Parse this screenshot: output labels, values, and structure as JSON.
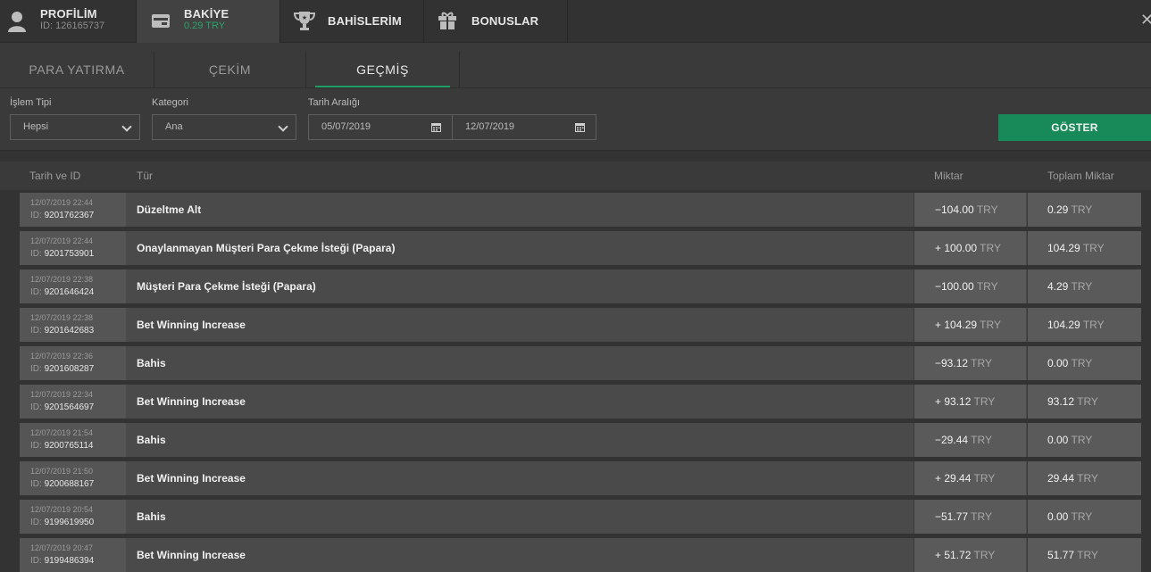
{
  "topnav": {
    "items": [
      {
        "title": "PROFİLİM",
        "sub": "ID: 126165737",
        "icon": "user-icon"
      },
      {
        "title": "BAKİYE",
        "sub": "0.29 TRY",
        "icon": "wallet-icon"
      },
      {
        "title": "BAHİSLERİM",
        "icon": "trophy-icon"
      },
      {
        "title": "BONUSLAR",
        "icon": "gift-icon"
      }
    ],
    "close": "✕"
  },
  "subtabs": [
    "PARA YATIRMA",
    "ÇEKİM",
    "GEÇMİŞ"
  ],
  "filters": {
    "type_label": "İşlem Tipi",
    "type_value": "Hepsi",
    "category_label": "Kategori",
    "category_value": "Ana",
    "date_label": "Tarih Aralığı",
    "date_from": "05/07/2019",
    "date_to": "12/07/2019",
    "show_button": "GÖSTER"
  },
  "table": {
    "headers": [
      "Tarih ve ID",
      "Tür",
      "Miktar",
      "Toplam Miktar"
    ],
    "id_prefix": "ID:",
    "currency": "TRY",
    "rows": [
      {
        "date": "12/07/2019 22:44",
        "id": "9201762367",
        "type": "Düzeltme Alt",
        "amount": "−104.00",
        "total": "0.29"
      },
      {
        "date": "12/07/2019 22:44",
        "id": "9201753901",
        "type": "Onaylanmayan Müşteri Para Çekme İsteği (Papara)",
        "amount": "+ 100.00",
        "total": "104.29"
      },
      {
        "date": "12/07/2019 22:38",
        "id": "9201646424",
        "type": "Müşteri Para Çekme İsteği (Papara)",
        "amount": "−100.00",
        "total": "4.29"
      },
      {
        "date": "12/07/2019 22:38",
        "id": "9201642683",
        "type": "Bet Winning Increase",
        "amount": "+ 104.29",
        "total": "104.29"
      },
      {
        "date": "12/07/2019 22:36",
        "id": "9201608287",
        "type": "Bahis",
        "amount": "−93.12",
        "total": "0.00"
      },
      {
        "date": "12/07/2019 22:34",
        "id": "9201564697",
        "type": "Bet Winning Increase",
        "amount": "+ 93.12",
        "total": "93.12"
      },
      {
        "date": "12/07/2019 21:54",
        "id": "9200765114",
        "type": "Bahis",
        "amount": "−29.44",
        "total": "0.00"
      },
      {
        "date": "12/07/2019 21:50",
        "id": "9200688167",
        "type": "Bet Winning Increase",
        "amount": "+ 29.44",
        "total": "29.44"
      },
      {
        "date": "12/07/2019 20:54",
        "id": "9199619950",
        "type": "Bahis",
        "amount": "−51.77",
        "total": "0.00"
      },
      {
        "date": "12/07/2019 20:47",
        "id": "9199486394",
        "type": "Bet Winning Increase",
        "amount": "+ 51.72",
        "total": "51.77"
      }
    ]
  },
  "colors": {
    "accent": "#188a5a",
    "balance": "#2aa36b"
  }
}
